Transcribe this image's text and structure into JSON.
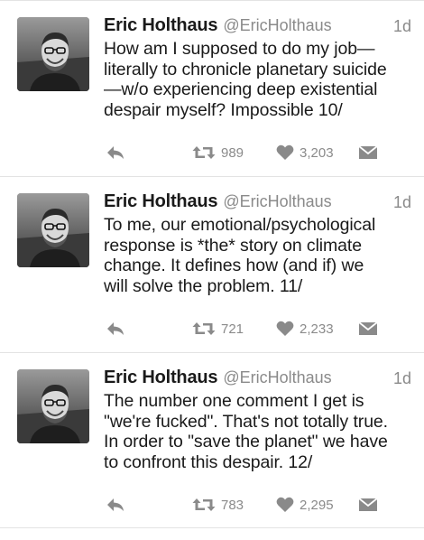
{
  "icons": {
    "reply": "reply-arrow-icon",
    "retweet": "retweet-icon",
    "like": "heart-icon",
    "dm": "envelope-icon"
  },
  "colors": {
    "text": "#1a1a1a",
    "muted": "#8a8a8a",
    "divider": "#e3e3e3"
  },
  "tweets": [
    {
      "author_name": "Eric Holthaus",
      "author_handle": "@EricHolthaus",
      "time": "1d",
      "lines": [
        "How am I supposed to do my job—",
        "literally to chronicle planetary suicide",
        "—w/o experiencing deep existential",
        "despair myself? Impossible 10/"
      ],
      "retweets": "989",
      "likes": "3,203"
    },
    {
      "author_name": "Eric Holthaus",
      "author_handle": "@EricHolthaus",
      "time": "1d",
      "lines": [
        "To me, our emotional/psychological",
        "response is *the* story on climate",
        "change. It defines how (and if) we",
        "will solve the problem. 11/"
      ],
      "retweets": "721",
      "likes": "2,233"
    },
    {
      "author_name": "Eric Holthaus",
      "author_handle": "@EricHolthaus",
      "time": "1d",
      "lines": [
        "The number one comment I get is",
        "\"we're fucked\". That's not totally true.",
        "In order to \"save the planet\" we have",
        "to confront this despair. 12/"
      ],
      "retweets": "783",
      "likes": "2,295"
    }
  ]
}
